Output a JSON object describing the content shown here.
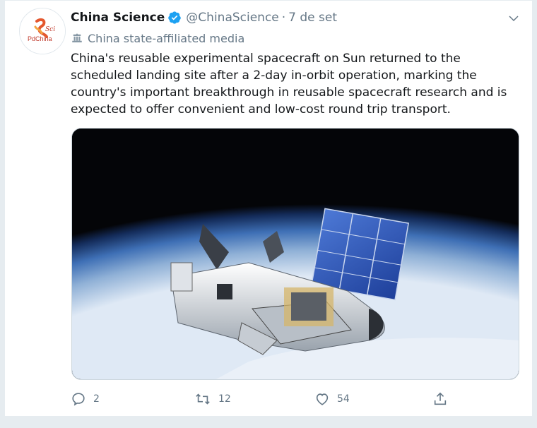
{
  "tweet": {
    "avatar": {
      "line1": "Sci",
      "line2": "PdChina"
    },
    "author_name": "China Science",
    "handle": "@ChinaScience",
    "separator": "·",
    "date": "7 de set",
    "affiliation": "China state-affiliated media",
    "text": "China's reusable experimental spacecraft on Sun returned to the scheduled landing site after a 2-day in-orbit operation, marking the country's important breakthrough in reusable spacecraft research and is expected to offer convenient and low-cost round trip transport.",
    "verified_color": "#1da1f2",
    "icons": {
      "verified": "verified-badge-icon",
      "caret": "chevron-down-icon",
      "affiliation": "state-media-icon",
      "reply": "reply-icon",
      "retweet": "retweet-icon",
      "like": "heart-icon",
      "share": "share-icon"
    }
  },
  "actions": {
    "reply_count": "2",
    "retweet_count": "12",
    "like_count": "54"
  }
}
